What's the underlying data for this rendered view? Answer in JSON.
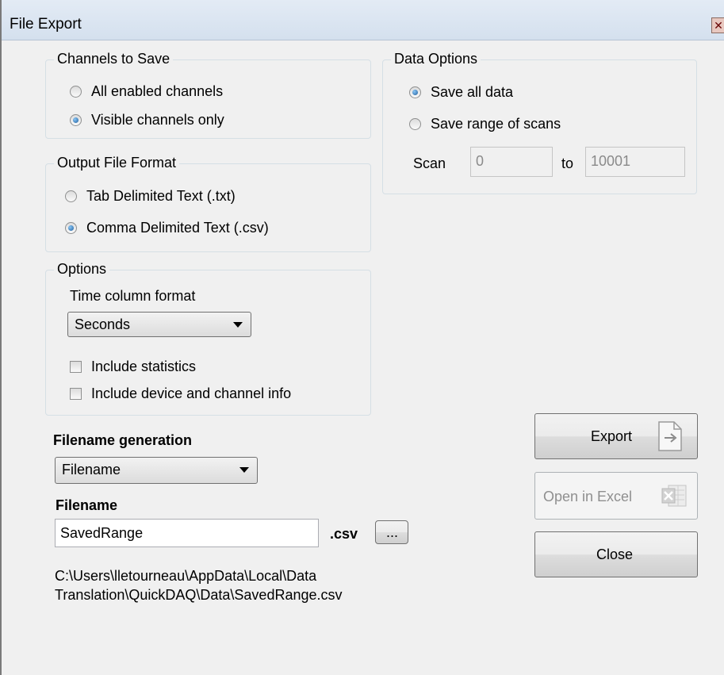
{
  "window": {
    "title": "File Export",
    "close_glyph": "✕"
  },
  "channels": {
    "legend": "Channels to Save",
    "options": [
      {
        "label": "All enabled channels",
        "checked": false
      },
      {
        "label": "Visible channels only",
        "checked": true
      }
    ]
  },
  "output_format": {
    "legend": "Output File Format",
    "options": [
      {
        "label": "Tab Delimited Text (.txt)",
        "checked": false
      },
      {
        "label": "Comma Delimited Text (.csv)",
        "checked": true
      }
    ]
  },
  "options": {
    "legend": "Options",
    "time_format_label": "Time column format",
    "time_format_value": "Seconds",
    "include_statistics": {
      "label": "Include statistics",
      "checked": false
    },
    "include_device_info": {
      "label": "Include device and channel info",
      "checked": false
    }
  },
  "data_options": {
    "legend": "Data Options",
    "save_all": {
      "label": "Save all data",
      "checked": true
    },
    "save_range": {
      "label": "Save range of scans",
      "checked": false
    },
    "scan_label": "Scan",
    "scan_from": "0",
    "to_label": "to",
    "scan_to": "10001"
  },
  "filename_generation": {
    "label": "Filename generation",
    "value": "Filename"
  },
  "filename": {
    "label": "Filename",
    "value": "SavedRange",
    "extension": ".csv",
    "browse_label": "...",
    "path_line1": "C:\\Users\\lletourneau\\AppData\\Local\\Data",
    "path_line2": "Translation\\QuickDAQ\\Data\\SavedRange.csv"
  },
  "buttons": {
    "export": "Export",
    "open_excel": "Open in Excel",
    "close": "Close"
  },
  "icons": {
    "export": "file-arrow-icon",
    "excel": "excel-icon"
  }
}
